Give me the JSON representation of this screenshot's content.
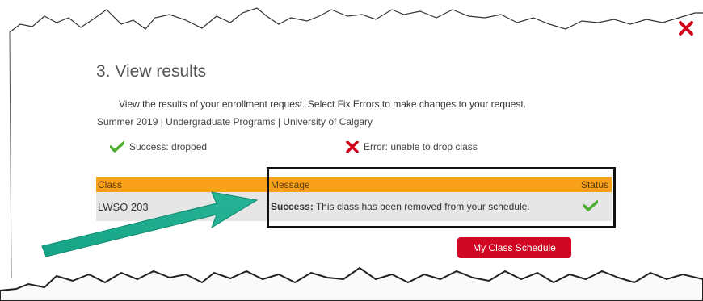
{
  "section": {
    "title": "3.  View results",
    "instructions": "View the results of your enrollment request.  Select Fix Errors to make changes to your request.",
    "term_line": "Summer 2019 | Undergraduate Programs | University of Calgary"
  },
  "legend": {
    "success_label": "Success: dropped",
    "error_label": "Error: unable to drop class"
  },
  "table": {
    "headers": {
      "class": "Class",
      "message": "Message",
      "status": "Status"
    },
    "rows": [
      {
        "class": "LWSO  203",
        "message_prefix": "Success:",
        "message_text": " This class has been removed from your schedule.",
        "status_icon": "checkmark-icon"
      }
    ]
  },
  "buttons": {
    "my_class_schedule": "My Class Schedule"
  },
  "colors": {
    "accent_orange": "#f9a11a",
    "button_red": "#cf0722",
    "close_red": "#d0021b",
    "success_green": "#4caf30",
    "annotation_arrow": "#1aa589"
  },
  "icons": {
    "close": "close-icon",
    "success": "checkmark-icon",
    "error": "x-icon"
  }
}
